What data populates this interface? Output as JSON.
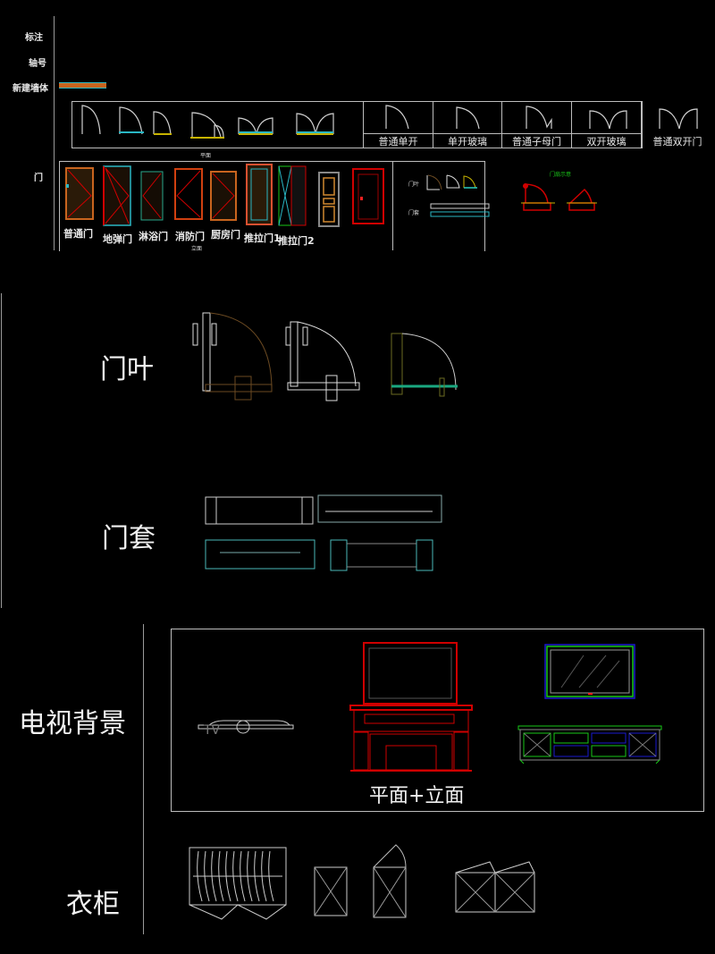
{
  "top_section": {
    "labels": {
      "annotation": "标注",
      "axis_number": "轴号",
      "new_wall": "新建墙体",
      "door": "门"
    },
    "plan_caption": "平面",
    "elevation_caption": "立面",
    "door_plan_types": [
      "普通单开",
      "单开玻璃",
      "普通子母门",
      "双开玻璃",
      "普通双开门"
    ],
    "door_elevation_types": [
      "普通门",
      "地弹门",
      "淋浴门",
      "消防门",
      "厨房门",
      "推拉门1",
      "推拉门2"
    ],
    "mini_legend": {
      "leaf": "门叶",
      "casing": "门套"
    },
    "red_group_caption": "门扇示意"
  },
  "sections": {
    "door_leaf": "门叶",
    "door_casing": "门套",
    "tv_background": "电视背景",
    "tv_caption": "平面+立面",
    "tv_plan_tag": "TV",
    "wardrobe": "衣柜"
  },
  "colors": {
    "background": "#000000",
    "line": "#bdbdbd",
    "wall_orange": "#c8641e",
    "cyan": "#2ab7c4",
    "yellow": "#c8b400",
    "red": "#d00000",
    "green": "#19c819",
    "blue": "#1a1ad0",
    "brown": "#6b4a22"
  }
}
